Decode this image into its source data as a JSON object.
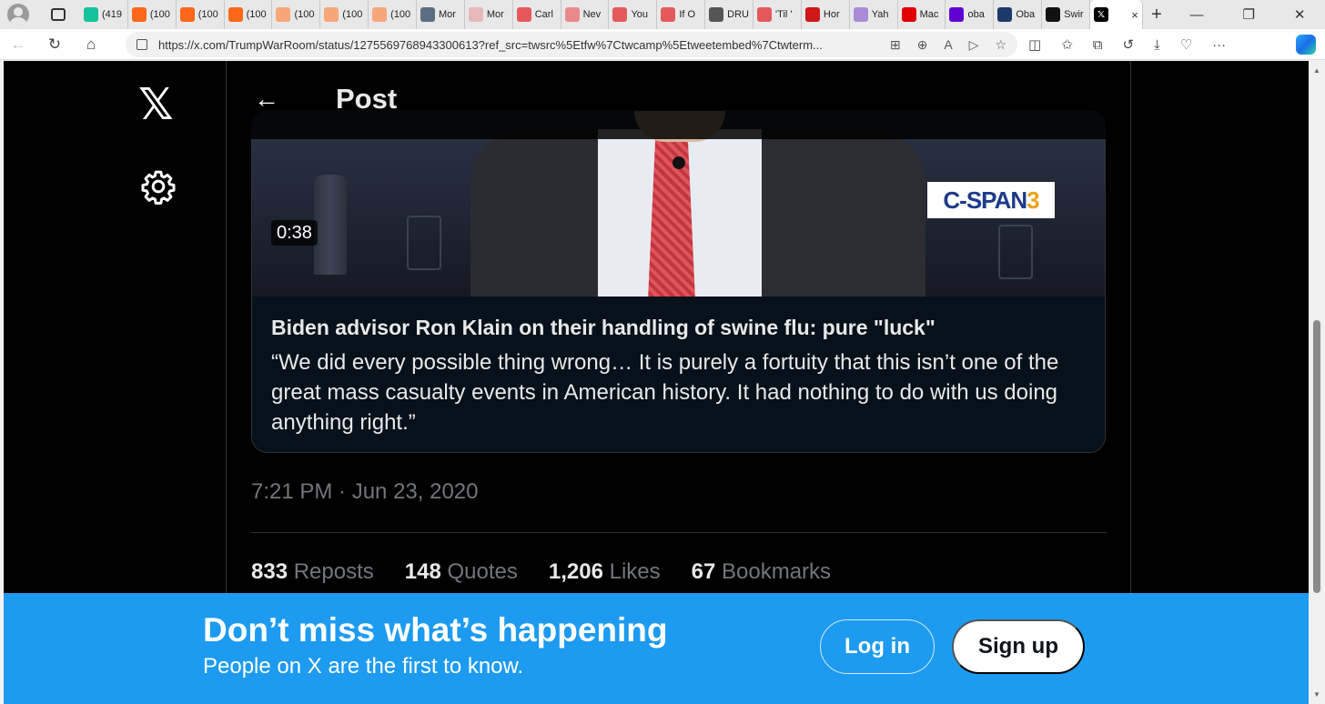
{
  "browser": {
    "tabs": [
      {
        "label": "(419",
        "icon": "grammarly-icon",
        "color": "#15c39a"
      },
      {
        "label": "(100",
        "icon": "substack-icon",
        "color": "#ff6719"
      },
      {
        "label": "(100",
        "icon": "substack-icon",
        "color": "#ff6719"
      },
      {
        "label": "(100",
        "icon": "substack-icon",
        "color": "#ff6719"
      },
      {
        "label": "(100",
        "icon": "substack-icon",
        "color": "#f7a77a"
      },
      {
        "label": "(100",
        "icon": "substack-icon",
        "color": "#f7a77a"
      },
      {
        "label": "(100",
        "icon": "substack-icon",
        "color": "#f7a77a"
      },
      {
        "label": "Mor",
        "icon": "wordpress-icon",
        "color": "#5a6e82"
      },
      {
        "label": "Mor",
        "icon": "bi-icon",
        "color": "#e7b8b8"
      },
      {
        "label": "Carl",
        "icon": "youtube-icon",
        "color": "#e45a5a"
      },
      {
        "label": "Nev",
        "icon": "site-icon",
        "color": "#e98a8a"
      },
      {
        "label": "You",
        "icon": "youtube-icon",
        "color": "#e45a5a"
      },
      {
        "label": "If O",
        "icon": "youtube-icon",
        "color": "#e45a5a"
      },
      {
        "label": "DRU",
        "icon": "drudge-icon",
        "color": "#555555"
      },
      {
        "label": "'Til '",
        "icon": "youtube-icon",
        "color": "#e45a5a"
      },
      {
        "label": "Hor",
        "icon": "site-icon",
        "color": "#d01818"
      },
      {
        "label": "Yah",
        "icon": "yahoo-icon",
        "color": "#a98bd8"
      },
      {
        "label": "Mac",
        "icon": "youtube-icon",
        "color": "#e00000"
      },
      {
        "label": "oba",
        "icon": "yahoo-icon",
        "color": "#6001d2"
      },
      {
        "label": "Oba",
        "icon": "news-icon",
        "color": "#1c3a6a"
      },
      {
        "label": "Swir",
        "icon": "openai-icon",
        "color": "#111111"
      }
    ],
    "active_tab_close": "×",
    "new_tab": "+",
    "window_controls": {
      "minimize": "—",
      "restore": "❐",
      "close": "✕"
    },
    "url": "https://x.com/TrumpWarRoom/status/1275569768943300613?ref_src=twsrc%5Etfw%7Ctwcamp%5Etweetembed%7Ctwterm...",
    "nav": {
      "back": "←",
      "reload": "↻",
      "home": "⌂"
    },
    "url_icons": [
      "⊞",
      "⊕",
      "A",
      "▷",
      "☆"
    ],
    "ext_icons": [
      "◫",
      "✩",
      "⧉",
      "↺",
      "⤓",
      "♡",
      "···"
    ]
  },
  "sidebar": {
    "logo": "𝕏"
  },
  "header": {
    "back": "←",
    "title": "Post"
  },
  "card": {
    "duration": "0:38",
    "watermark_main": "C-SPAN",
    "watermark_num": "3",
    "headline": "Biden advisor Ron Klain on their handling of swine flu: pure \"luck\"",
    "description": "“We did every possible thing wrong… It is purely a fortuity that this isn’t one of the great mass casualty events in American history. It had nothing to do with us doing anything right.”"
  },
  "post": {
    "timestamp": "7:21 PM · Jun 23, 2020",
    "stats": {
      "reposts_count": "833",
      "reposts_label": "Reposts",
      "quotes_count": "148",
      "quotes_label": "Quotes",
      "likes_count": "1,206",
      "likes_label": "Likes",
      "bookmarks_count": "67",
      "bookmarks_label": "Bookmarks"
    }
  },
  "banner": {
    "title": "Don’t miss what’s happening",
    "subtitle": "People on X are the first to know.",
    "login_label": "Log in",
    "signup_label": "Sign up",
    "color": "#1d9bf0"
  }
}
